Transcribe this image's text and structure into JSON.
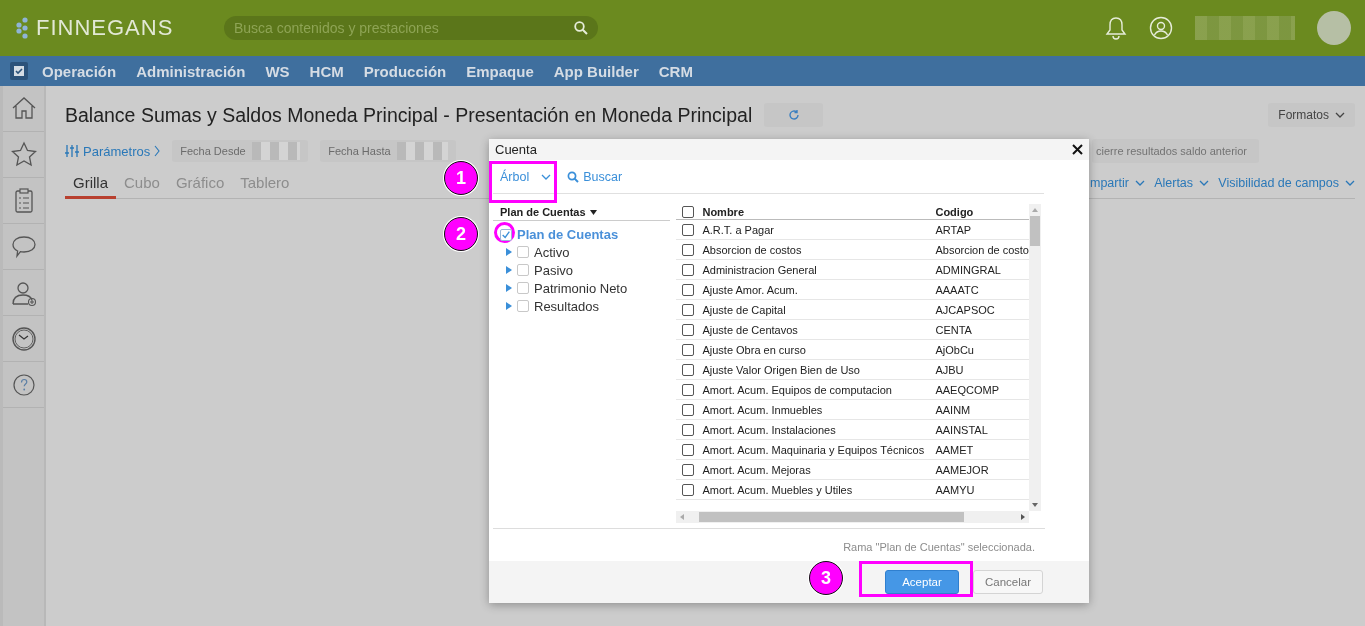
{
  "header": {
    "logo": "FINNEGANS",
    "search": {
      "placeholder": "Busca contenidos y prestaciones"
    }
  },
  "menu": [
    "Operación",
    "Administración",
    "WS",
    "HCM",
    "Producción",
    "Empaque",
    "App Builder",
    "CRM"
  ],
  "page": {
    "title": "Balance Sumas y Saldos Moneda Principal - Presentación en Moneda Principal",
    "formats_button": "Formatos",
    "parameters_link": "Parámetros",
    "filters": [
      {
        "label": "Fecha Desde"
      },
      {
        "label": "Fecha Hasta"
      }
    ],
    "filter_right": "cierre resultados saldo anterior",
    "tabs": [
      {
        "label": "Grilla",
        "selected": true
      },
      {
        "label": "Cubo",
        "selected": false
      },
      {
        "label": "Gráfico",
        "selected": false
      },
      {
        "label": "Tablero",
        "selected": false
      }
    ],
    "actions": [
      "mpartir",
      "Alertas",
      "Visibilidad de campos"
    ]
  },
  "dialog": {
    "title": "Cuenta",
    "view_menu": "Árbol",
    "search_link": "Buscar",
    "tree": {
      "header": "Plan de Cuentas",
      "root": {
        "label": "Plan de Cuentas",
        "checked": true,
        "children": [
          {
            "label": "Activo",
            "checked": false,
            "expanded": false
          },
          {
            "label": "Pasivo",
            "checked": false,
            "expanded": false
          },
          {
            "label": "Patrimonio Neto",
            "checked": false,
            "expanded": false
          },
          {
            "label": "Resultados",
            "checked": false,
            "expanded": false
          }
        ]
      }
    },
    "grid": {
      "select_all": false,
      "columns": [
        "Nombre",
        "Codigo"
      ],
      "rows": [
        {
          "name": "A.R.T. a Pagar",
          "code": "ARTAP",
          "checked": false
        },
        {
          "name": "Absorcion de costos",
          "code": "Absorcion de costo",
          "checked": false
        },
        {
          "name": "Administracion General",
          "code": "ADMINGRAL",
          "checked": false
        },
        {
          "name": "Ajuste Amor. Acum.",
          "code": "AAAATC",
          "checked": false
        },
        {
          "name": "Ajuste de Capital",
          "code": "AJCAPSOC",
          "checked": false
        },
        {
          "name": "Ajuste de Centavos",
          "code": "CENTA",
          "checked": false
        },
        {
          "name": "Ajuste Obra en curso",
          "code": "AjObCu",
          "checked": false
        },
        {
          "name": "Ajuste Valor Origen Bien de Uso",
          "code": "AJBU",
          "checked": false
        },
        {
          "name": "Amort. Acum. Equipos de computacion",
          "code": "AAEQCOMP",
          "checked": false
        },
        {
          "name": "Amort. Acum. Inmuebles",
          "code": "AAINM",
          "checked": false
        },
        {
          "name": "Amort. Acum. Instalaciones",
          "code": "AAINSTAL",
          "checked": false
        },
        {
          "name": "Amort. Acum. Maquinaria y Equipos Técnicos",
          "code": "AAMET",
          "checked": false
        },
        {
          "name": "Amort. Acum. Mejoras",
          "code": "AAMEJOR",
          "checked": false
        },
        {
          "name": "Amort. Acum. Muebles y Utiles",
          "code": "AAMYU",
          "checked": false
        }
      ]
    },
    "status": "Rama \"Plan de Cuentas\" seleccionada.",
    "buttons": [
      {
        "label": "Aceptar",
        "kind": "primary"
      },
      {
        "label": "Cancelar",
        "kind": "secondary"
      }
    ]
  },
  "annotations": [
    "1",
    "2",
    "3"
  ]
}
